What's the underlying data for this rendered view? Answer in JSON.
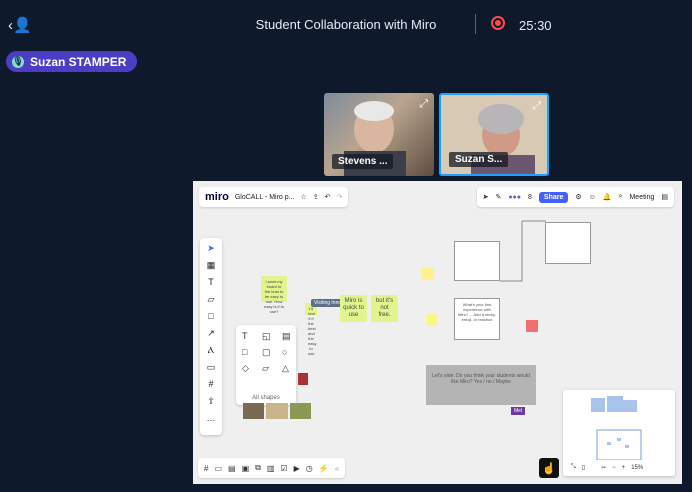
{
  "header": {
    "title": "Student Collaboration with Miro",
    "timer": "25:30"
  },
  "speaker": {
    "name": "Suzan STAMPER"
  },
  "participants": [
    {
      "name": "Stevens ..."
    },
    {
      "name": "Suzan S..."
    }
  ],
  "miro": {
    "logo": "miro",
    "board_title": "GloCALL - Miro p...",
    "share_label": "Share",
    "meeting_label": "Meeting",
    "avatar_count": "8",
    "shapes_label": "All shapes",
    "zoom": "15%",
    "stickies": {
      "s1": "I want my board to the lead to be easy to use. How easy is it to use?",
      "s2": "I'd love it if the best and the easy to use",
      "s3": "Miro is quick to use",
      "s4": "but it's not free."
    },
    "white_note": "What's your first experience with Miro? ... Add a sticky, emoji, or reaction",
    "gray_note": "Let's vote: Do you think your students would like Miro? Yes / no / Maybe",
    "tooltip": "Visiting Innovator",
    "tag": "Mel",
    "colors": {
      "accent": "#4262ff",
      "speaker": "#4c3ec4",
      "record": "#ff4b4b"
    }
  }
}
